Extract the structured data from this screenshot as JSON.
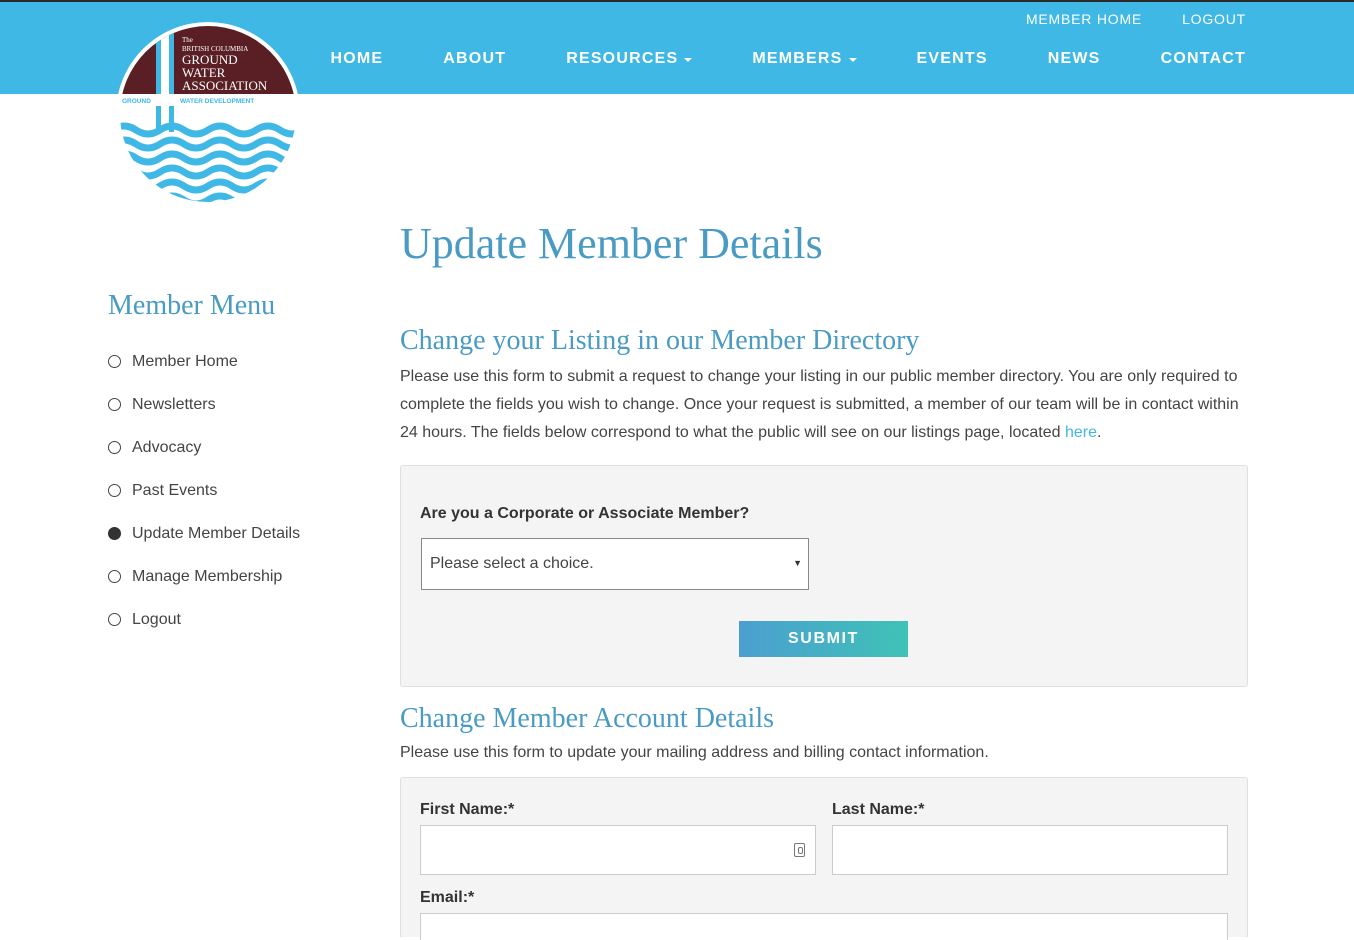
{
  "header": {
    "logo": {
      "line1": "The",
      "line2": "BRITISH COLUMBIA",
      "line3": "GROUND",
      "line4": "WATER",
      "line5": "ASSOCIATION",
      "left_tag": "GROUND",
      "right_tag": "WATER DEVELOPMENT"
    },
    "util_nav": [
      "MEMBER HOME",
      "LOGOUT"
    ],
    "main_nav": [
      {
        "label": "HOME"
      },
      {
        "label": "ABOUT"
      },
      {
        "label": "RESOURCES"
      },
      {
        "label": "MEMBERS"
      },
      {
        "label": "EVENTS"
      },
      {
        "label": "NEWS"
      },
      {
        "label": "CONTACT"
      }
    ]
  },
  "sidebar": {
    "title": "Member Menu",
    "items": [
      {
        "label": "Member Home"
      },
      {
        "label": "Newsletters"
      },
      {
        "label": "Advocacy"
      },
      {
        "label": "Past Events"
      },
      {
        "label": "Update Member Details"
      },
      {
        "label": "Manage Membership"
      },
      {
        "label": "Logout"
      }
    ]
  },
  "main": {
    "title": "Update Member Details",
    "listing": {
      "title": "Change your Listing in our Member Directory",
      "intro": "Please use this form to submit a request to change your listing in our public member directory. You are only required to complete the fields you wish to change. Once your request is submitted, a member of our team will be in contact within 24 hours. The fields below correspond to what the public will see on our listings page, located ",
      "link_text": "here",
      "after_link": ".",
      "question": "Are you a Corporate or Associate Member?",
      "select_value": "Please select a choice.",
      "submit_label": "SUBMIT"
    },
    "account": {
      "title": "Change Member Account Details",
      "intro": "Please use this form to update your mailing address and billing contact information.",
      "first_name_label": "First Name:*",
      "last_name_label": "Last Name:*",
      "email_label": "Email:*"
    }
  },
  "colors": {
    "header_bg": "#3fb8e6",
    "heading": "#4a9bc4",
    "logo_maroon": "#5a1f24",
    "wave_blue": "#3fb8e6"
  }
}
